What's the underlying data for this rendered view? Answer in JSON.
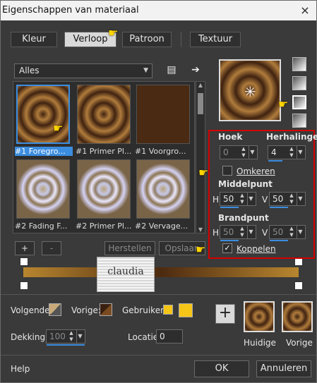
{
  "window": {
    "title": "Eigenschappen van materiaal",
    "close": "×"
  },
  "tabs": [
    {
      "label": "Kleur"
    },
    {
      "label": "Verloop"
    },
    {
      "label": "Patroon"
    },
    {
      "label": "Textuur"
    }
  ],
  "library": {
    "dropdown_value": "Alles",
    "items": [
      {
        "label": "#1 Foregro..."
      },
      {
        "label": "#1 Primer Pl..."
      },
      {
        "label": "#1 Voorgro..."
      },
      {
        "label": "#2 Fading F..."
      },
      {
        "label": "#2 Primer Pl..."
      },
      {
        "label": "#2 Vervage..."
      }
    ],
    "add": "+",
    "remove": "-",
    "reset": "Herstellen",
    "save": "Opslaan"
  },
  "properties": {
    "hoek_label": "Hoek",
    "hoek_value": "0",
    "herhalingen_label": "Herhalingen",
    "herhalingen_value": "4",
    "omkeren_label": "Omkeren",
    "middelpunt_label": "Middelpunt",
    "mid_h_label": "H",
    "mid_h_value": "50",
    "mid_v_label": "V",
    "mid_v_value": "50",
    "brandpunt_label": "Brandpunt",
    "br_h_label": "H",
    "br_h_value": "50",
    "br_v_label": "V",
    "br_v_value": "50",
    "koppelen_label": "Koppelen",
    "koppelen_checked": "✓"
  },
  "watermark": {
    "text": "claudia"
  },
  "footer": {
    "volgende_label": "Volgende:",
    "vorige_label": "Vorige:",
    "gebruiker_label": "Gebruiker:",
    "dekking_label": "Dekking:",
    "dekking_value": "100",
    "locatie_label": "Locatie:",
    "locatie_value": "0",
    "add_btn": "+",
    "huidige": "Huidige",
    "vorige": "Vorige",
    "help": "Help",
    "ok": "OK",
    "cancel": "Annuleren"
  },
  "colors": {
    "accent": "#3b8de0",
    "highlight_red": "#d60000",
    "user_color": "#f5c518"
  }
}
